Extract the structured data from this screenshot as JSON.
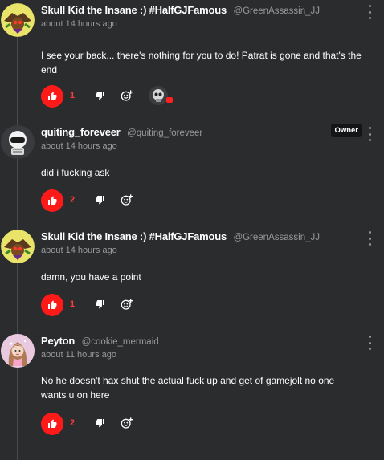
{
  "colors": {
    "accent": "#ff1a1a",
    "background": "#2b2c2e",
    "muted": "#9a9a9a"
  },
  "comments": [
    {
      "display_name": "Skull Kid the Insane :) #HalfGJFamous",
      "username": "@GreenAssassin_JJ",
      "time": "about 14 hours ago",
      "text": "I see your back... there's nothing for you to do! Patrat is gone and that's the end",
      "likes": "1",
      "avatar_icon": "skull-kid-avatar"
    },
    {
      "display_name": "quiting_foreveer",
      "username": "@quiting_foreveer",
      "badge": "Owner",
      "time": "about 14 hours ago",
      "text": "did i fucking ask",
      "likes": "2",
      "avatar_icon": "robot-avatar"
    },
    {
      "display_name": "Skull Kid the Insane :) #HalfGJFamous",
      "username": "@GreenAssassin_JJ",
      "time": "about 14 hours ago",
      "text": "damn, you have a point",
      "likes": "1",
      "avatar_icon": "skull-kid-avatar"
    },
    {
      "display_name": "Peyton",
      "username": "@cookie_mermaid",
      "time": "about 11 hours ago",
      "text": "No he doesn't hax shut the actual fuck up and get of gamejolt no one wants u on here",
      "likes": "2",
      "avatar_icon": "mermaid-avatar"
    }
  ]
}
